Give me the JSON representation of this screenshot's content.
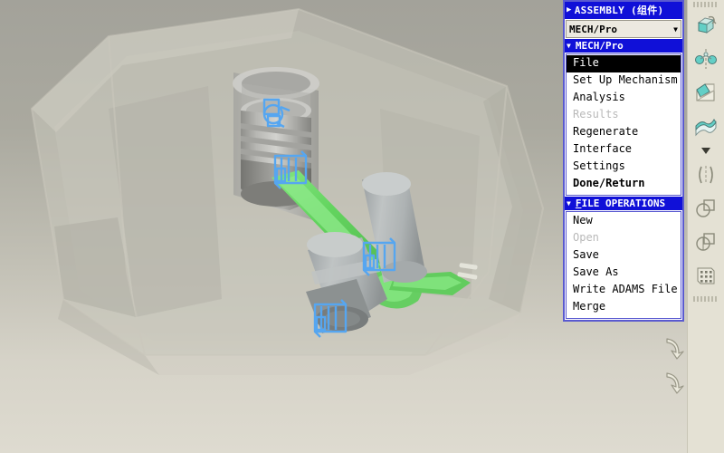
{
  "window": {
    "background_top_color": "#a3a29a",
    "background_bottom_color": "#dedbd0"
  },
  "viewport": {
    "name": "3d-model-viewport",
    "model_description": "Engine block cutaway assembly with piston, connecting rod and crankshaft",
    "highlight_part_color": "#3ed93e",
    "joint_marker_color": "#1e90ff",
    "body_color": "#8d8d8d",
    "housing_color": "#b9b7ae"
  },
  "menu_manager": {
    "title": "ASSEMBLY (组件)",
    "title_triangle": "▶",
    "combo_value": "MECH/Pro",
    "combo_arrow": "▼",
    "sections": [
      {
        "name": "mech-pro",
        "triangle": "▼",
        "label": "MECH/Pro",
        "items": [
          {
            "label": "File",
            "state": "selected"
          },
          {
            "label": "Set Up Mechanism",
            "state": "normal"
          },
          {
            "label": "Analysis",
            "state": "normal"
          },
          {
            "label": "Results",
            "state": "disabled"
          },
          {
            "label": "Regenerate",
            "state": "normal"
          },
          {
            "label": "Interface",
            "state": "normal"
          },
          {
            "label": "Settings",
            "state": "normal"
          },
          {
            "label": "Done/Return",
            "state": "bold"
          }
        ]
      },
      {
        "name": "file-operations",
        "triangle": "▼",
        "label_html": "<u>F</u>ILE OPERATIONS",
        "label": "FILE OPERATIONS",
        "items": [
          {
            "label": "New",
            "state": "normal"
          },
          {
            "label": "Open",
            "state": "disabled"
          },
          {
            "label": "Save",
            "state": "normal"
          },
          {
            "label": "Save As",
            "state": "normal"
          },
          {
            "label": "Write ADAMS File",
            "state": "normal"
          },
          {
            "label": "Merge",
            "state": "normal"
          }
        ]
      }
    ]
  },
  "right_toolbar": {
    "name": "view-toolbar",
    "buttons": [
      {
        "icon": "spin-model-icon",
        "tooltip": "Spin model"
      },
      {
        "icon": "datum-axis-icon",
        "tooltip": "Datum axis display"
      },
      {
        "icon": "datum-plane-icon",
        "tooltip": "Datum plane display"
      },
      {
        "icon": "surface-shade-icon",
        "tooltip": "Shade surfaces"
      },
      {
        "icon": "mirror-icon",
        "tooltip": "Mirror"
      },
      {
        "icon": "intersect-icon",
        "tooltip": "Intersect"
      },
      {
        "icon": "subtract-icon",
        "tooltip": "Subtract"
      },
      {
        "icon": "pattern-grid-icon",
        "tooltip": "Pattern"
      }
    ],
    "caret": "▼"
  },
  "corner_tools": {
    "name": "drag-handle-tools",
    "buttons": [
      {
        "icon": "rotate-arrow-icon"
      },
      {
        "icon": "rotate-arrow-icon"
      }
    ]
  }
}
